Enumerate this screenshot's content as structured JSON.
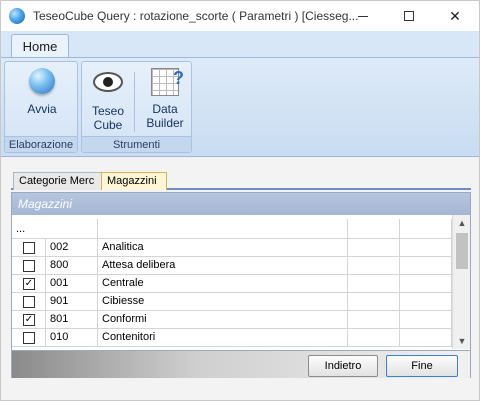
{
  "window": {
    "title": "TeseoCube Query : rotazione_scorte ( Parametri ) [Ciesseg...",
    "controls": {
      "minimize": "",
      "maximize": "",
      "close": "✕"
    }
  },
  "ribbon": {
    "tab": "Home",
    "groups": [
      {
        "label": "Elaborazione",
        "buttons": [
          {
            "label": "Avvia",
            "icon": "globe-icon"
          }
        ]
      },
      {
        "label": "Strumenti",
        "buttons": [
          {
            "label_line1": "Teseo",
            "label_line2": "Cube",
            "icon": "eye-icon"
          },
          {
            "label_line1": "Data",
            "label_line2": "Builder",
            "icon": "data-builder-icon"
          }
        ]
      }
    ]
  },
  "tabs": [
    {
      "label": "Categorie Merc",
      "active": false
    },
    {
      "label": "Magazzini",
      "active": true
    }
  ],
  "panel": {
    "title": "Magazzini",
    "first_row": "...",
    "rows": [
      {
        "checked": false,
        "code": "002",
        "name": "Analitica"
      },
      {
        "checked": false,
        "code": "800",
        "name": "Attesa delibera"
      },
      {
        "checked": true,
        "code": "001",
        "name": "Centrale"
      },
      {
        "checked": false,
        "code": "901",
        "name": "Cibiesse"
      },
      {
        "checked": true,
        "code": "801",
        "name": "Conformi"
      },
      {
        "checked": false,
        "code": "010",
        "name": "Contenitori"
      }
    ]
  },
  "buttons": {
    "back": "Indietro",
    "finish": "Fine"
  },
  "check_mark": "✓",
  "scroll": {
    "up": "▲",
    "down": "▼"
  }
}
